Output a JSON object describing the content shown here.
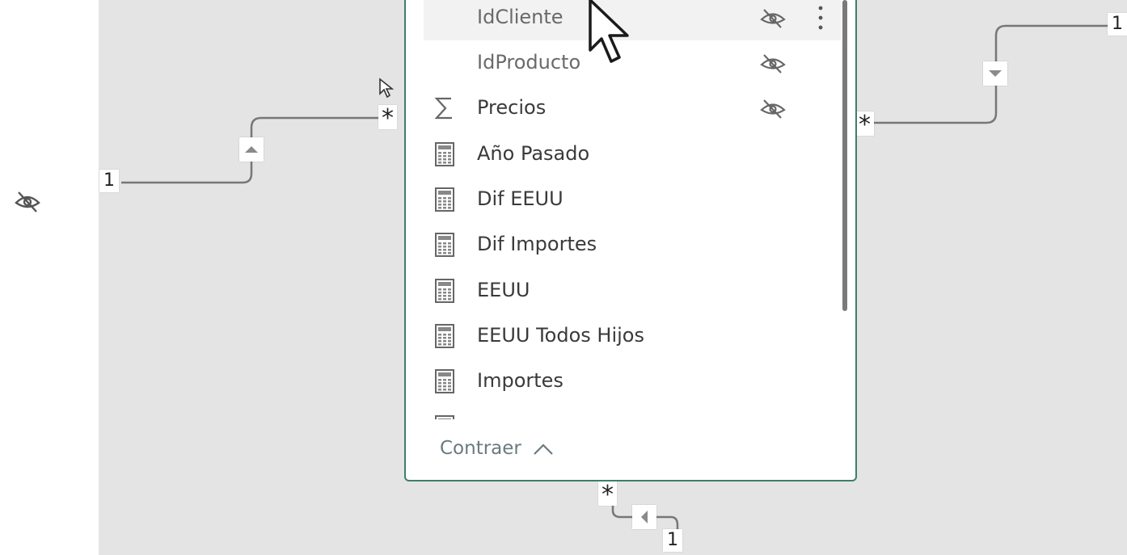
{
  "table": {
    "fields": [
      {
        "name": "IdCliente",
        "type": "key",
        "hidden": true,
        "hovered": true
      },
      {
        "name": "IdProducto",
        "type": "key",
        "hidden": true,
        "hovered": false
      },
      {
        "name": "Precios",
        "type": "sum",
        "hidden": true,
        "hovered": false
      },
      {
        "name": "Año Pasado",
        "type": "measure",
        "hidden": false,
        "hovered": false
      },
      {
        "name": "Dif EEUU",
        "type": "measure",
        "hidden": false,
        "hovered": false
      },
      {
        "name": "Dif Importes",
        "type": "measure",
        "hidden": false,
        "hovered": false
      },
      {
        "name": "EEUU",
        "type": "measure",
        "hidden": false,
        "hovered": false
      },
      {
        "name": "EEUU Todos Hijos",
        "type": "measure",
        "hidden": false,
        "hovered": false
      },
      {
        "name": "Importes",
        "type": "measure",
        "hidden": false,
        "hovered": false
      }
    ],
    "collapse_label": "Contraer",
    "border_color": "#3d7f68"
  },
  "relationships": {
    "left": {
      "one_label": "1",
      "many_label": "*",
      "direction": "up"
    },
    "right": {
      "one_label": "1",
      "many_label": "*",
      "direction": "down"
    },
    "bottom": {
      "one_label": "1",
      "many_label": "*",
      "direction": "left"
    }
  },
  "icons": {
    "hidden": "eye-slash-icon",
    "more": "vertical-ellipsis-icon",
    "sum": "sigma-icon",
    "measure": "calculator-icon",
    "collapse": "chevron-up-icon",
    "cursor": "mouse-pointer-icon"
  },
  "colors": {
    "canvas": "#e4e4e4",
    "card": "#ffffff",
    "accent": "#3d7f68"
  }
}
